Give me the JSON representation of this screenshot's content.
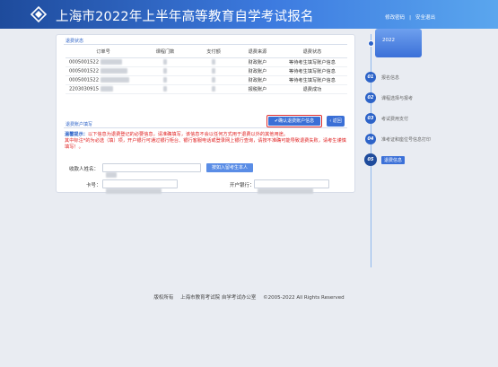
{
  "header": {
    "title": "上海市2022年上半年高等教育自学考试报名",
    "links": {
      "modify_password": "修改密码",
      "separator": "|",
      "logout": "安全退出"
    }
  },
  "payment_section": {
    "title": "退费状态",
    "columns": [
      "订单号",
      "课程门数",
      "支付额",
      "退费来源",
      "退费状态"
    ],
    "rows": [
      {
        "order": "0005001522",
        "source": "财政账户",
        "status": "等待考生填写账户信息",
        "status_type": "red"
      },
      {
        "order": "0005001522",
        "source": "财政账户",
        "status": "等待考生填写账户信息",
        "status_type": "red"
      },
      {
        "order": "0005001522",
        "source": "财政账户",
        "status": "等待考生填写账户信息",
        "status_type": "red"
      },
      {
        "order": "2203030915",
        "source": "报税账户",
        "status": "退费成功",
        "status_type": "green"
      }
    ]
  },
  "account_section": {
    "title": "退费账户填写",
    "confirm_button": "✔确认退费账户信息",
    "back_button": "‹ 返回",
    "notice_label": "温馨提示：",
    "notice_text": "以下信息为退费登记的必要信息，请准确填写，该信息不会以任何方式用于退费以外的其他用途。",
    "notice_line2": "其中标注*的为必选（填）项，开户银行可通过银行柜台、银行客服电话或登录网上银行查询，请按不准确可能导致退费失败，请考生谨慎填写！。",
    "payee_label": "收款人姓名：",
    "fill_button": "按如入留考生本人",
    "card_label": "卡号：",
    "bank_label": "开户银行："
  },
  "timeline": {
    "current": "2022",
    "steps": [
      {
        "num": "01",
        "label": "报名信息"
      },
      {
        "num": "02",
        "label": "课程选择与报考"
      },
      {
        "num": "03",
        "label": "考试费用支付"
      },
      {
        "num": "04",
        "label": "准考证和座位号信息打印"
      },
      {
        "num": "05",
        "label": "退费信息"
      }
    ]
  },
  "footer": {
    "copyright": "版权所有",
    "org": "上海市教育考试院 自学考试办公室",
    "years": "©2005-2022 All Rights Reserved"
  },
  "colors": {
    "header_start": "#1e4b9c",
    "header_end": "#5aa6ee",
    "accent": "#2d63c8",
    "error": "#e02020",
    "success": "#1fa31f"
  }
}
